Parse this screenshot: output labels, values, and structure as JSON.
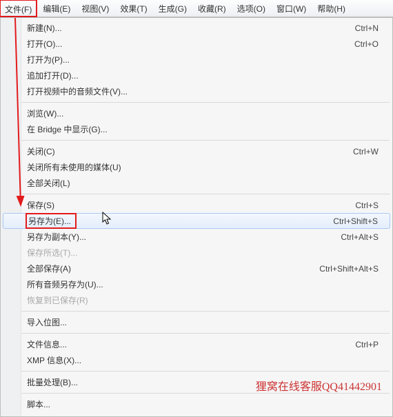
{
  "menubar": [
    {
      "label": "文件(F)",
      "highlight": true
    },
    {
      "label": "编辑(E)"
    },
    {
      "label": "视图(V)"
    },
    {
      "label": "效果(T)"
    },
    {
      "label": "生成(G)"
    },
    {
      "label": "收藏(R)"
    },
    {
      "label": "选项(O)"
    },
    {
      "label": "窗口(W)"
    },
    {
      "label": "帮助(H)"
    }
  ],
  "dropdown": [
    {
      "t": "item",
      "label": "新建(N)...",
      "sc": "Ctrl+N"
    },
    {
      "t": "item",
      "label": "打开(O)...",
      "sc": "Ctrl+O"
    },
    {
      "t": "item",
      "label": "打开为(P)..."
    },
    {
      "t": "item",
      "label": "追加打开(D)..."
    },
    {
      "t": "item",
      "label": "打开视频中的音频文件(V)..."
    },
    {
      "t": "sep"
    },
    {
      "t": "item",
      "label": "浏览(W)..."
    },
    {
      "t": "item",
      "label": "在 Bridge 中显示(G)..."
    },
    {
      "t": "sep"
    },
    {
      "t": "item",
      "label": "关闭(C)",
      "sc": "Ctrl+W"
    },
    {
      "t": "item",
      "label": "关闭所有未使用的媒体(U)"
    },
    {
      "t": "item",
      "label": "全部关闭(L)"
    },
    {
      "t": "sep"
    },
    {
      "t": "item",
      "label": "保存(S)",
      "sc": "Ctrl+S"
    },
    {
      "t": "item",
      "label": "另存为(E)...",
      "sc": "Ctrl+Shift+S",
      "hovered": true,
      "boxed": true
    },
    {
      "t": "item",
      "label": "另存为副本(Y)...",
      "sc": "Ctrl+Alt+S"
    },
    {
      "t": "item",
      "label": "保存所选(T)...",
      "disabled": true
    },
    {
      "t": "item",
      "label": "全部保存(A)",
      "sc": "Ctrl+Shift+Alt+S"
    },
    {
      "t": "item",
      "label": "所有音频另存为(U)..."
    },
    {
      "t": "item",
      "label": "恢复到已保存(R)",
      "disabled": true
    },
    {
      "t": "sep"
    },
    {
      "t": "item",
      "label": "导入位图..."
    },
    {
      "t": "sep"
    },
    {
      "t": "item",
      "label": "文件信息...",
      "sc": "Ctrl+P"
    },
    {
      "t": "item",
      "label": "XMP 信息(X)..."
    },
    {
      "t": "sep"
    },
    {
      "t": "item",
      "label": "批量处理(B)..."
    },
    {
      "t": "sep"
    },
    {
      "t": "item",
      "label": "脚本..."
    }
  ],
  "watermark": "狸窝在线客服QQ41442901"
}
